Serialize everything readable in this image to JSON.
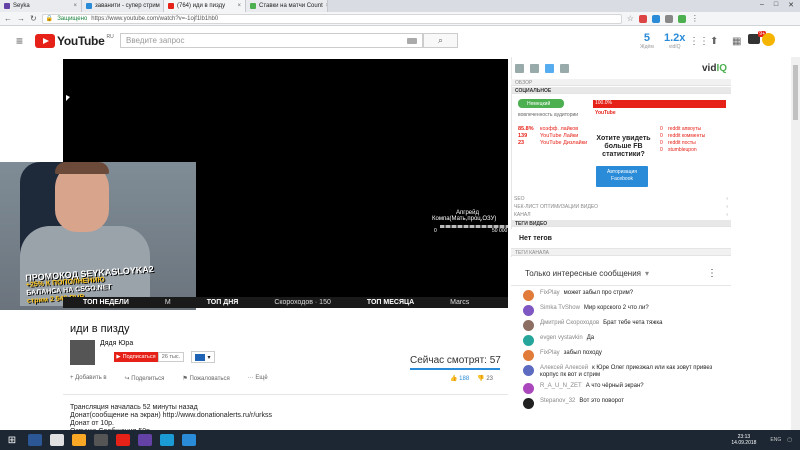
{
  "browser": {
    "tabs": [
      {
        "title": "Seyka",
        "color": "#6441a4"
      },
      {
        "title": "заванити - супер стрим",
        "color": "#2a8bd8"
      },
      {
        "title": "(764) иди в пизду",
        "color": "#e62117"
      },
      {
        "title": "Ставки на матчи Count",
        "color": "#4caf50"
      }
    ],
    "secure_label": "Защищено",
    "url": "https://www.youtube.com/watch?v=-1ojf1lb1hb0"
  },
  "youtube": {
    "logo_text": "YouTube",
    "logo_region": "RU",
    "search_placeholder": "Введите запрос",
    "stat1": {
      "value": "5",
      "label": "Ждём"
    },
    "stat2": {
      "value": "1.2x",
      "label": "vidIQ"
    },
    "notif_count": "9+"
  },
  "player": {
    "upgrade_label": "Апгрейд",
    "comp_label": "Компа(Мать,проц,ОЗУ)",
    "progress_start": "0",
    "progress_end": "50 000",
    "progress_fraction": 0.0,
    "ticker": [
      {
        "label": "ТОП НЕДЕЛИ",
        "sep": "М"
      },
      {
        "label": "ТОП ДНЯ",
        "sep": "Скороходов · 150"
      },
      {
        "label": "ТОП МЕСЯЦА",
        "sep": "Marcs"
      }
    ]
  },
  "overlay": {
    "promo_line1": "ПРОМОКОД SEYKASLOYKA2",
    "promo_line2": "+25% К ПОПОЛНЕНИЮ",
    "promo_line3": "БАЛАНСА НА CSGO.NET",
    "promo_line4": "стрим 2 540 RUB"
  },
  "video": {
    "title": "иди в пизду",
    "channel": "Дядя Юра",
    "subscribe_label": "Подписаться",
    "sub_count": "26 тыс.",
    "viewers_label": "Сейчас смотрят: 57",
    "actions": [
      "Добавить в",
      "Поделиться",
      "Пожаловаться",
      "Ещё"
    ],
    "likes": "188",
    "dislikes": "23",
    "description": "Трансляция началась 52 минуты назад\nДонат(сообщение на экран) http://www.donationalerts.ru/r/urkss\nДонат от 10р.\nОзвучка Сообщения 50р."
  },
  "vidiq": {
    "logo_a": "vid",
    "logo_b": "IQ",
    "sect_overview": "ОБЗОР",
    "sect_social": "СОЦИАЛЬНОЕ",
    "social_pill": "Немецкий",
    "social_pill_label": "вовлеченность аудитории",
    "yt_pct": "100.0%",
    "yt_label": "YouTube",
    "fb_stats": [
      {
        "n": "85.8%",
        "l": "коэфф. лайков"
      },
      {
        "n": "139",
        "l": "YouTube Лайки"
      },
      {
        "n": "23",
        "l": "YouTube Дизлайки"
      }
    ],
    "fb_cta": "Хотите увидеть больше FB статистики?",
    "fb_btn_line1": "Авторизация",
    "fb_btn_line2": "Facebook",
    "reddit": [
      {
        "n": "0",
        "l": "reddit апвоуты"
      },
      {
        "n": "0",
        "l": "reddit комменты"
      },
      {
        "n": "0",
        "l": "reddit посты"
      },
      {
        "n": "0",
        "l": "stumbleupon"
      }
    ],
    "rows": [
      {
        "label": "SEO",
        "caret": "‹"
      },
      {
        "label": "ЧЕК-ЛИСТ ОПТИМИЗАЦИИ ВИДЕО",
        "caret": "‹"
      },
      {
        "label": "КАНАЛ",
        "caret": "‹"
      }
    ],
    "sect_tags": "ТЕГИ ВИДЕО",
    "tags_value": "Нет тегов",
    "sect_channel_tags": "ТЕГИ КАНАЛА"
  },
  "chat": {
    "header": "Только интересные сообщения",
    "messages": [
      {
        "author": "FixPlay",
        "text": "может забыл про стрим?",
        "color": "#e07b39"
      },
      {
        "author": "Simka TvShow",
        "text": "Мир корского 2 что ли?",
        "color": "#7e57c2"
      },
      {
        "author": "Дмитрий Скороходов",
        "text": "Брат тебе чета тяжка",
        "color": "#8d6e63"
      },
      {
        "author": "evgen vystavkin",
        "text": "Да",
        "color": "#26a69a"
      },
      {
        "author": "FixPlay",
        "text": "забыл походу",
        "color": "#e07b39"
      },
      {
        "author": "Алексей Алексей",
        "text": "к Юре Олег приезжал или как зовут привез корпус пк вот и стрим",
        "color": "#5c6bc0"
      },
      {
        "author": "R_A_U_N_ZET",
        "text": "А что чёрный экран?",
        "color": "#ab47bc"
      },
      {
        "author": "Stepanov_32",
        "text": "Вот это поворот",
        "color": "#212121"
      }
    ]
  },
  "taskbar": {
    "time": "23:13",
    "date": "14.09.2018",
    "lang": "ENG",
    "apps": [
      "#2b5797",
      "#e0e0e0",
      "#f9a825",
      "#555",
      "#e62117",
      "#6441a4",
      "#1b9bd6",
      "#2a8bd8"
    ]
  }
}
